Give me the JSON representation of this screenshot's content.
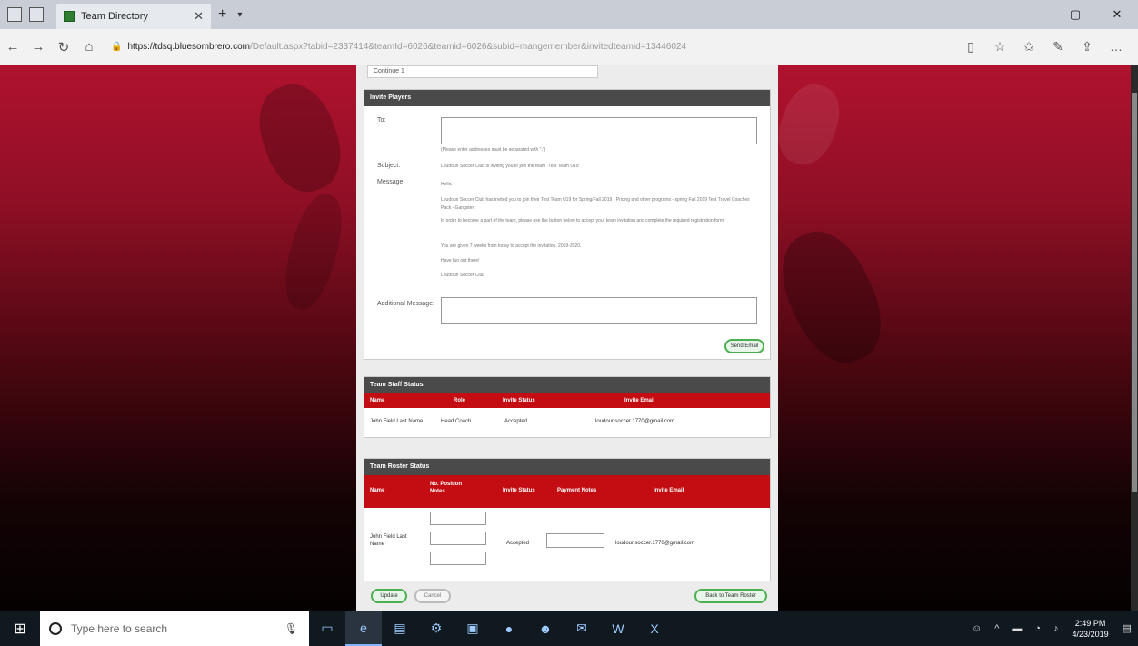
{
  "browser": {
    "tab_title": "Team Directory",
    "url_host": "https://tdsq.bluesombrero.com",
    "url_path": "/Default.aspx?tabid=2337414&teamId=6026&teamid=6026&subid=mangemember&invitedteamid=13446024"
  },
  "page": {
    "top_box_text": "Continue 1",
    "invite": {
      "header": "Invite Players",
      "to_label": "To:",
      "to_hint": "(Please enter addresses must be separated with \";\")",
      "subject_label": "Subject:",
      "subject_text": "Loudoun Soccer Club is inviting you to join the team \"Test Team U19\"",
      "message_label": "Message:",
      "message_lines": [
        "Hello,",
        "Loudoun Soccer Club has invited you to join their Test Team U19 for Spring/Fall 2019 - Pricing and other programs - spring Fall 2019 Test Travel Coaches Pack - Gangster.",
        "In order to become a part of the team, please use the button below to accept your team invitation and complete the required registration form.",
        "You are given 7 weeks from today to accept the invitation. 2019-2020.",
        "Have fun out there!",
        "Loudoun Soccer Club"
      ],
      "additional_label": "Additional Message:",
      "send_button": "Send Email"
    },
    "staff": {
      "header": "Team Staff Status",
      "columns": [
        "Name",
        "Role",
        "Invite Status",
        "Invite Email"
      ],
      "rows": [
        {
          "name": "John Field Last Name",
          "role": "Head Coach",
          "status": "Accepted",
          "email": "loudounsoccer.1770@gmail.com"
        }
      ]
    },
    "roster": {
      "header": "Team Roster Status",
      "columns": [
        "Name",
        "No. Position Notes",
        "Invite Status",
        "Payment Notes",
        "Invite Email"
      ],
      "row": {
        "name": "John Field Last Name",
        "status": "Accepted",
        "email": "loudounsoccer.1770@gmail.com"
      }
    },
    "buttons": {
      "update": "Update",
      "cancel": "Cancel",
      "back": "Back to Team Roster"
    }
  },
  "taskbar": {
    "search_placeholder": "Type here to search",
    "time": "2:49 PM",
    "date": "4/23/2019"
  }
}
